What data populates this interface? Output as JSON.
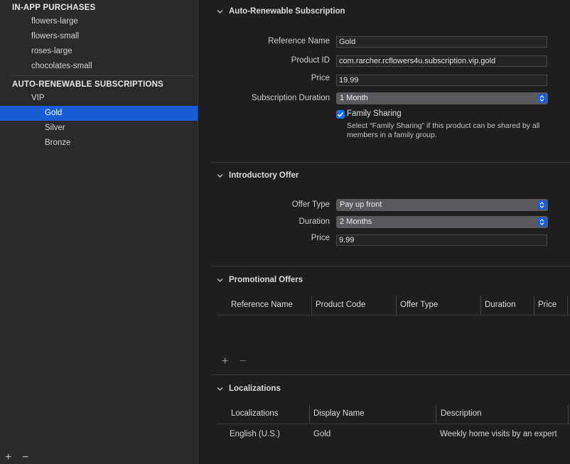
{
  "sidebar": {
    "iap_header": "IN-APP PURCHASES",
    "iap_items": [
      "flowers-large",
      "flowers-small",
      "roses-large",
      "chocolates-small"
    ],
    "ars_header": "AUTO-RENEWABLE SUBSCRIPTIONS",
    "group_name": "VIP",
    "group_items": [
      "Gold",
      "Silver",
      "Bronze"
    ],
    "selected_item": "Gold",
    "add_label": "+",
    "remove_label": "−"
  },
  "subscription": {
    "section_title": "Auto-Renewable Subscription",
    "reference_name_label": "Reference Name",
    "reference_name_value": "Gold",
    "product_id_label": "Product ID",
    "product_id_value": "com.rarcher.rcflowers4u.subscription.vip.gold",
    "price_label": "Price",
    "price_value": "19.99",
    "duration_label": "Subscription Duration",
    "duration_value": "1 Month",
    "family_sharing_label": "Family Sharing",
    "family_sharing_checked": true,
    "family_sharing_help_1": "Select “Family Sharing” if this product can be shared by all",
    "family_sharing_help_2": "members in a family group."
  },
  "intro_offer": {
    "section_title": "Introductory Offer",
    "offer_type_label": "Offer Type",
    "offer_type_value": "Pay up front",
    "duration_label": "Duration",
    "duration_value": "2 Months",
    "price_label": "Price",
    "price_value": "9.99"
  },
  "promo_offers": {
    "section_title": "Promotional Offers",
    "columns": [
      "Reference Name",
      "Product Code",
      "Offer Type",
      "Duration",
      "Price"
    ],
    "add_label": "+",
    "remove_label": "−"
  },
  "localizations": {
    "section_title": "Localizations",
    "columns": [
      "Localizations",
      "Display Name",
      "Description"
    ],
    "rows": [
      {
        "locale": "English (U.S.)",
        "display_name": "Gold",
        "description": "Weekly home visits by an expert"
      }
    ]
  },
  "colors": {
    "accent": "#1a5cd6",
    "sidebar_bg": "#2a2a2c",
    "main_bg": "#1e1e1e"
  }
}
